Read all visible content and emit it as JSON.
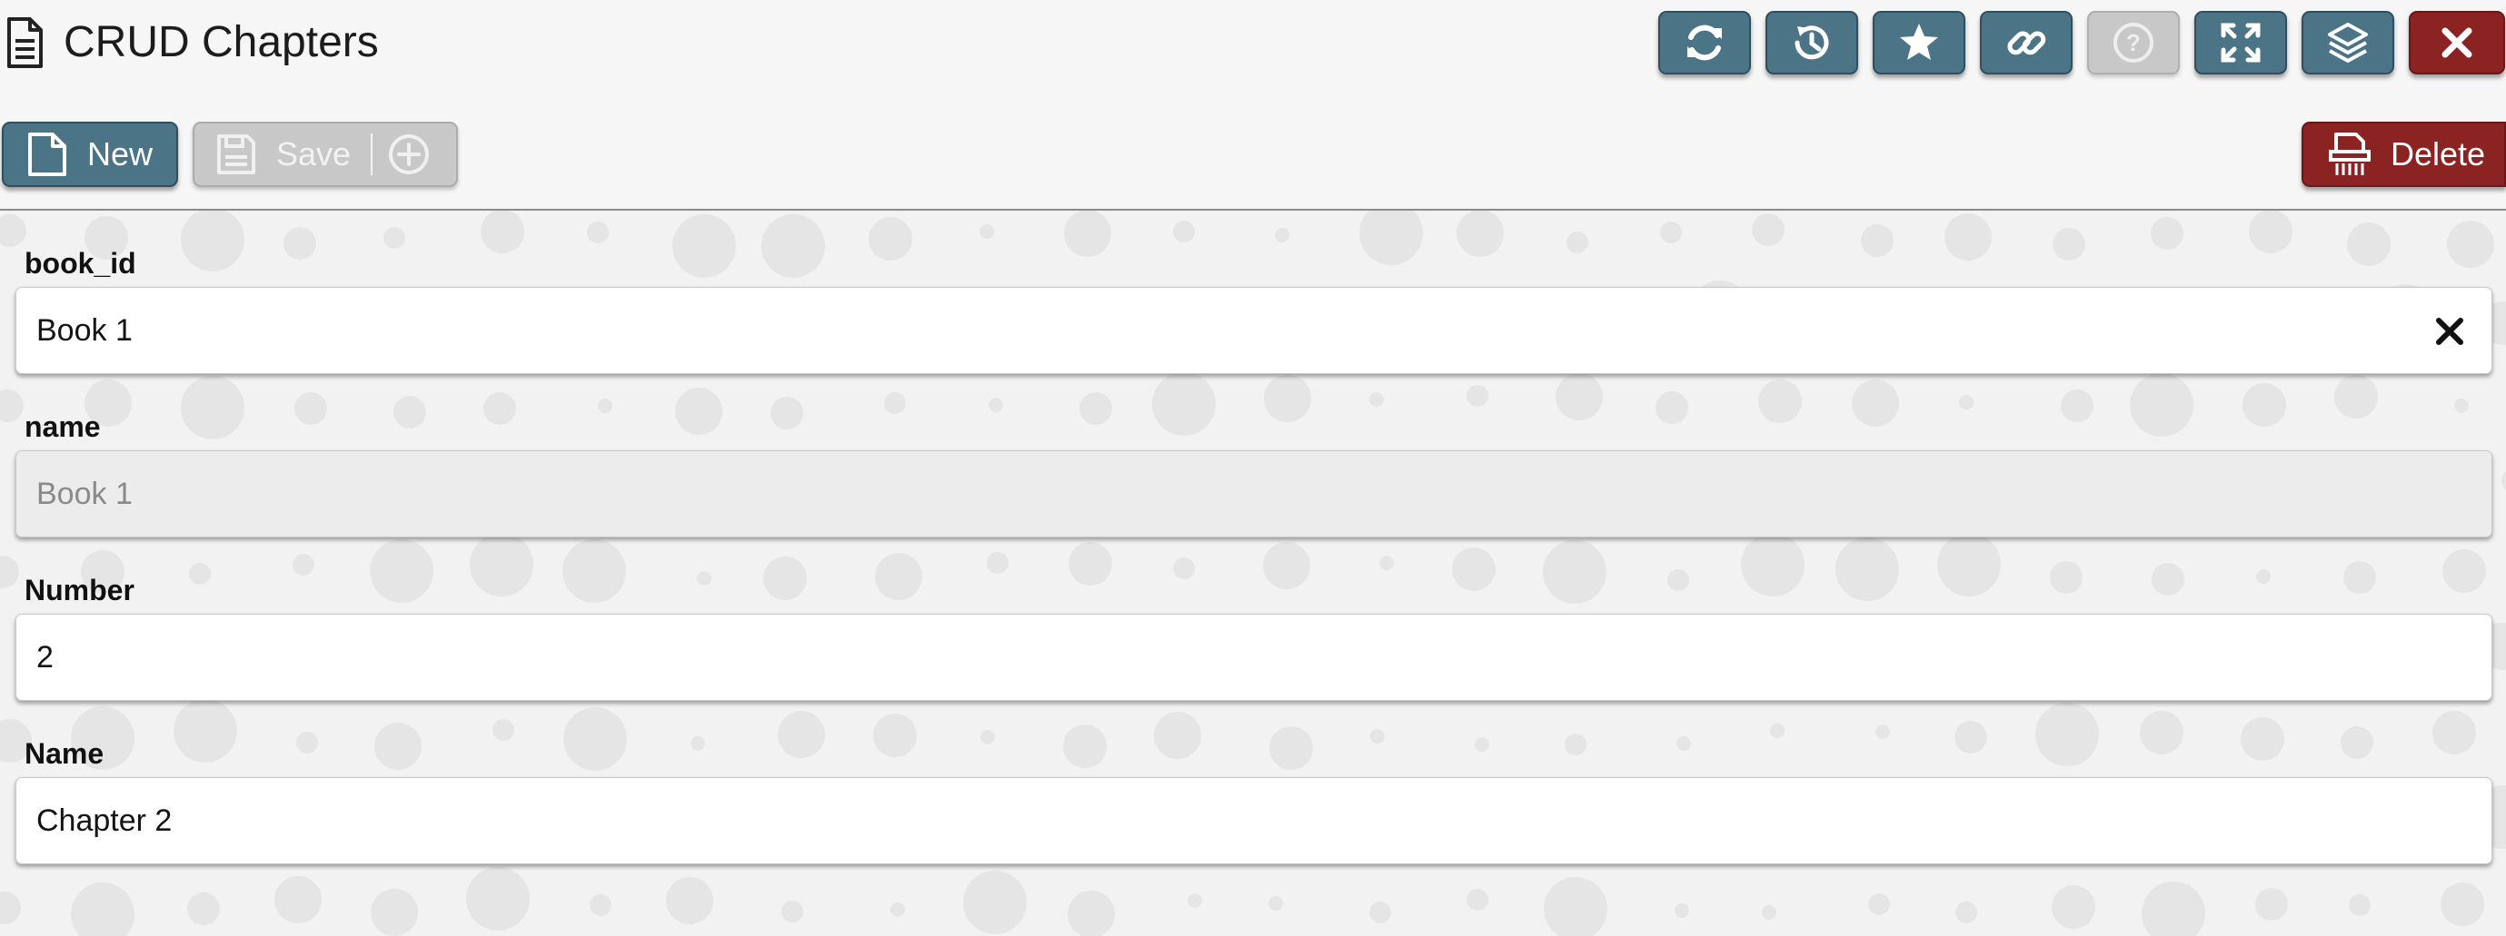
{
  "header": {
    "title": "CRUD Chapters",
    "icon": "document-icon",
    "toolbar": [
      {
        "icon": "refresh-icon",
        "enabled": true
      },
      {
        "icon": "history-icon",
        "enabled": true
      },
      {
        "icon": "star-icon",
        "enabled": true
      },
      {
        "icon": "link-icon",
        "enabled": true
      },
      {
        "icon": "help-icon",
        "enabled": false
      },
      {
        "icon": "expand-icon",
        "enabled": true
      },
      {
        "icon": "layers-icon",
        "enabled": true
      },
      {
        "icon": "close-icon",
        "enabled": true
      }
    ]
  },
  "actions": {
    "new_label": "New",
    "save_label": "Save",
    "delete_label": "Delete"
  },
  "form": {
    "fields": [
      {
        "label": "book_id",
        "value": "Book 1",
        "clearable": true,
        "readonly": false
      },
      {
        "label": "name",
        "value": "Book 1",
        "clearable": false,
        "readonly": true
      },
      {
        "label": "Number",
        "value": "2",
        "clearable": false,
        "readonly": false
      },
      {
        "label": "Name",
        "value": "Chapter 2",
        "clearable": false,
        "readonly": false
      }
    ]
  },
  "colors": {
    "primary": "#4b7487",
    "danger": "#8c2323",
    "disabled": "#c8c8c8",
    "background": "#f2f2f2"
  }
}
